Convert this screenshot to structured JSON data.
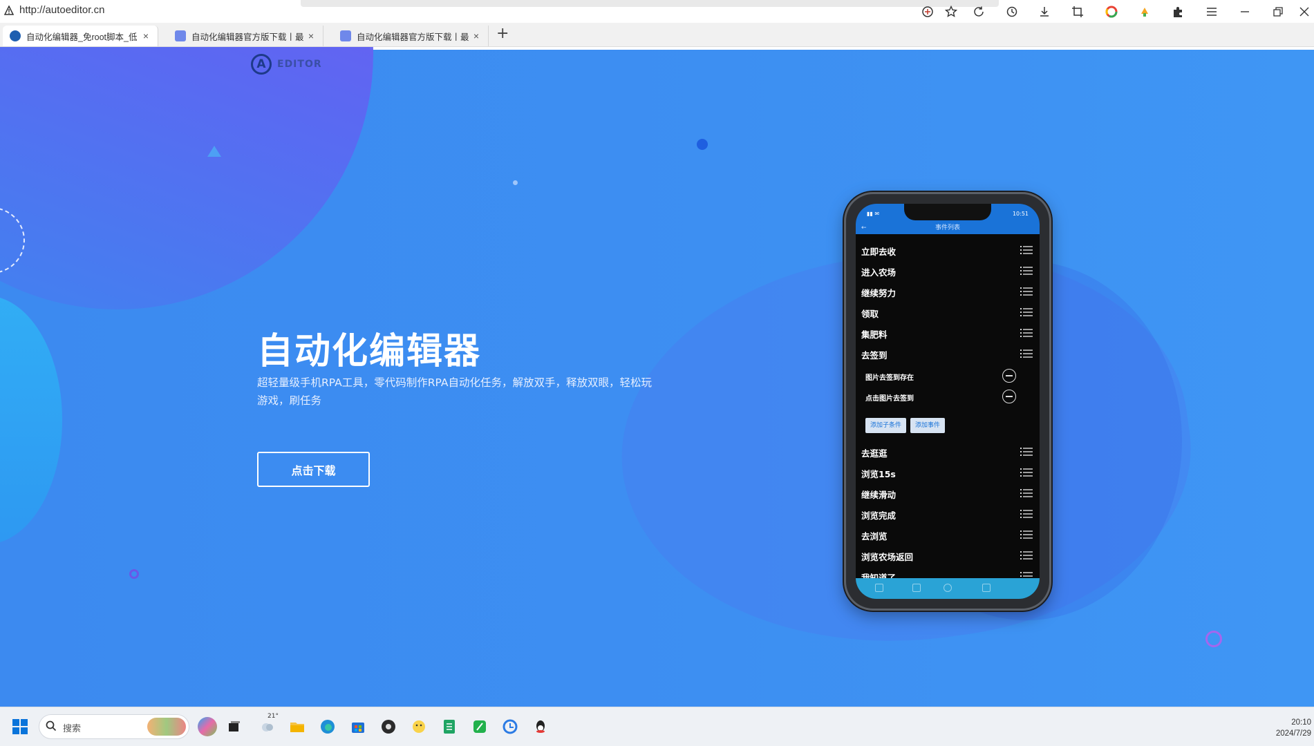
{
  "browser": {
    "address": "http://autoeditor.cn",
    "tabs": [
      {
        "title": "自动化编辑器_免root脚本_低",
        "active": true,
        "favicon_color": "#1f5fb0"
      },
      {
        "title": "自动化编辑器官方版下载丨最",
        "active": false,
        "favicon_color": "#5b7fe8"
      },
      {
        "title": "自动化编辑器官方版下载丨最",
        "active": false,
        "favicon_color": "#5b7fe8"
      }
    ],
    "new_tab_label": "+",
    "close_label": "×",
    "toolbar_icons": [
      "translate-icon",
      "star-icon",
      "reload-icon",
      "history-icon",
      "download-icon",
      "crop-icon",
      "color-circle-icon",
      "extension-paint-icon",
      "extensions-icon",
      "menu-icon",
      "minimize-icon",
      "restore-icon",
      "close-window-icon"
    ]
  },
  "site": {
    "logo_mark": "A",
    "logo_text": "EDITOR",
    "hero_title": "自动化编辑器",
    "hero_subtitle": "超轻量级手机RPA工具，零代码制作RPA自动化任务，解放双手，释放双眼，轻松玩游戏，刷任务",
    "download_button": "点击下载"
  },
  "phone": {
    "status_time": "10:51",
    "appbar_title": "事件列表",
    "rows": [
      "立即去收",
      "进入农场",
      "继续努力",
      "领取",
      "集肥料",
      "去签到"
    ],
    "sub_rows": [
      "图片去签到存在",
      "点击图片去签到"
    ],
    "sub_buttons": [
      "添加子条件",
      "添加事件"
    ],
    "rows_after": [
      "去逛逛",
      "浏览15s",
      "继续滑动",
      "浏览完成",
      "去浏览",
      "浏览农场返回",
      "我知道了"
    ]
  },
  "taskbar": {
    "search_placeholder": "搜索",
    "weather": "21°",
    "time": "20:10",
    "date": "2024/7/29"
  },
  "colors": {
    "page_blue": "#3d8ff2",
    "purple_blob": "#8052f3",
    "phone_appbar": "#1a73d8"
  }
}
